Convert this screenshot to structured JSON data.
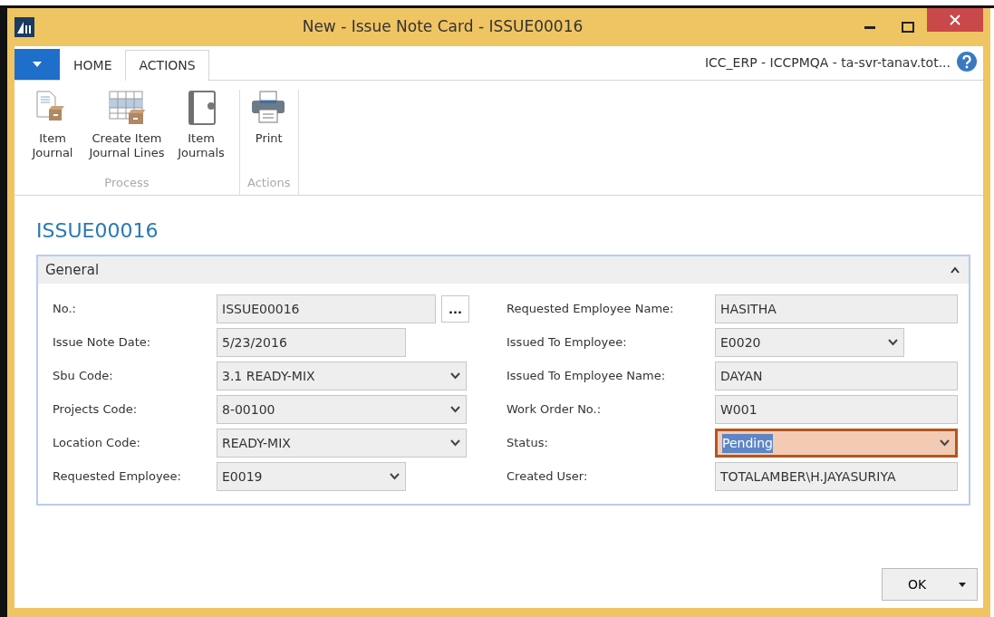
{
  "window": {
    "title": "New - Issue Note Card - ISSUE00016"
  },
  "tabs": [
    {
      "label": "HOME",
      "selected": false
    },
    {
      "label": "ACTIONS",
      "selected": true
    }
  ],
  "connection": "ICC_ERP - ICCPMQA - ta-svr-tanav.tot...",
  "ribbon_groups": [
    {
      "label": "Process",
      "actions": [
        {
          "label": "Item Journal",
          "kind": "journal"
        },
        {
          "label": "Create Item Journal Lines",
          "kind": "lines"
        },
        {
          "label": "Item Journals",
          "kind": "book"
        }
      ]
    },
    {
      "label": "Actions",
      "actions": [
        {
          "label": "Print",
          "kind": "print"
        }
      ]
    }
  ],
  "heading": "ISSUE00016",
  "section": {
    "title": "General",
    "expanded": true
  },
  "left_fields": [
    {
      "label": "No.:",
      "value": "ISSUE00016",
      "kind": "lookup",
      "focused": false,
      "button": "..."
    },
    {
      "label": "Issue Note Date:",
      "value": "5/23/2016",
      "kind": "short",
      "focused": false
    },
    {
      "label": "Sbu Code:",
      "value": "3.1 READY-MIX",
      "kind": "dropdown",
      "focused": false
    },
    {
      "label": "Projects Code:",
      "value": "8-00100",
      "kind": "dropdown",
      "focused": false
    },
    {
      "label": "Location Code:",
      "value": "READY-MIX",
      "kind": "dropdown",
      "focused": false
    },
    {
      "label": "Requested Employee:",
      "value": "E0019",
      "kind": "short-dropdown",
      "focused": false
    }
  ],
  "right_fields": [
    {
      "label": "Requested Employee Name:",
      "value": "HASITHA",
      "kind": "text",
      "focused": false
    },
    {
      "label": "Issued To Employee:",
      "value": "E0020",
      "kind": "short-dropdown",
      "focused": false
    },
    {
      "label": "Issued To Employee Name:",
      "value": "DAYAN",
      "kind": "text",
      "focused": false
    },
    {
      "label": "Work Order No.:",
      "value": "W001",
      "kind": "text",
      "focused": false
    },
    {
      "label": "Status:",
      "value": "Pending",
      "kind": "dropdown",
      "focused": true
    },
    {
      "label": "Created User:",
      "value": "TOTALAMBER\\H.JAYASURIYA",
      "kind": "text",
      "focused": false
    }
  ],
  "buttons": [
    {
      "label": "OK"
    }
  ]
}
